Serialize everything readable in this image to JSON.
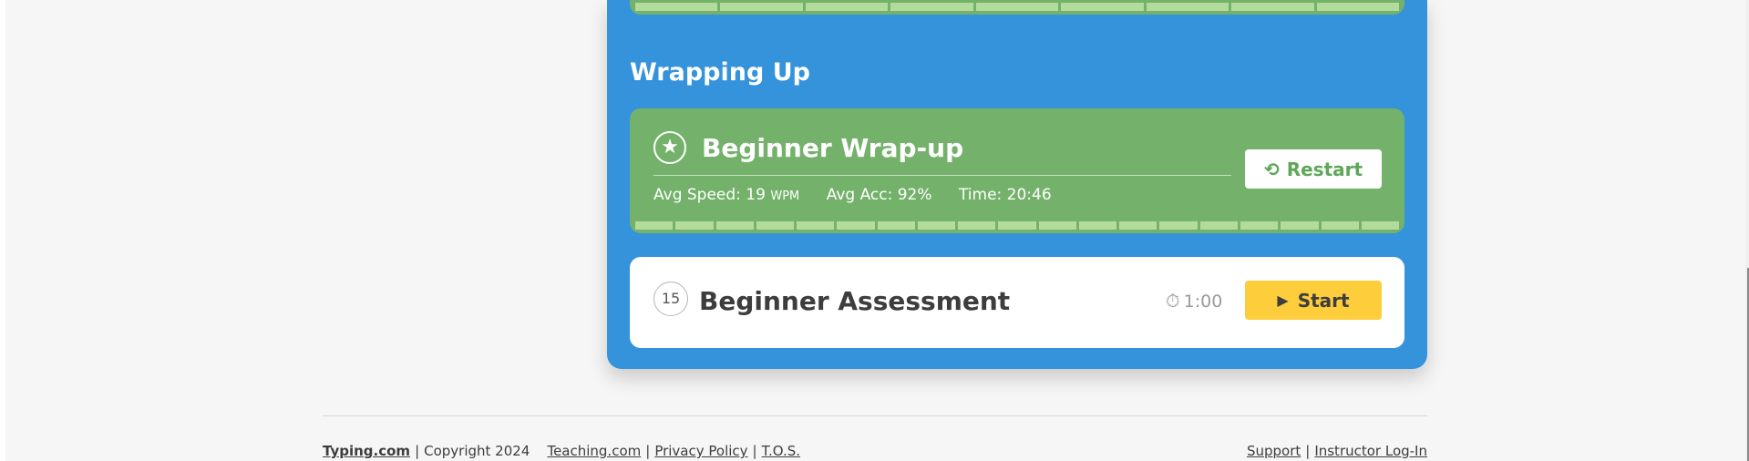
{
  "section": {
    "title": "Wrapping Up"
  },
  "wrapup": {
    "icon": "star-circle-icon",
    "title": "Beginner Wrap-up",
    "avg_speed_label": "Avg Speed: 19",
    "avg_speed_unit": "WPM",
    "avg_acc": "Avg Acc: 92%",
    "time": "Time: 20:46",
    "restart_label": "Restart",
    "restart_icon": "history-icon",
    "progress_segments": 19
  },
  "assessment": {
    "number": "15",
    "title": "Beginner Assessment",
    "timer_icon": "stopwatch-icon",
    "duration": "1:00",
    "start_label": "Start",
    "start_icon": "play-icon"
  },
  "previous_card": {
    "progress_segments": 9
  },
  "footer": {
    "brand": "Typing.com",
    "copyright": "Copyright 2024",
    "teaching": "Teaching.com",
    "privacy": "Privacy Policy",
    "tos": "T.O.S.",
    "support": "Support",
    "instructor_login": "Instructor Log-In"
  },
  "colors": {
    "panel_blue": "#3593dc",
    "complete_green": "#74b26b",
    "progress_green": "#b3dc9c",
    "start_yellow": "#fdcd3c"
  }
}
